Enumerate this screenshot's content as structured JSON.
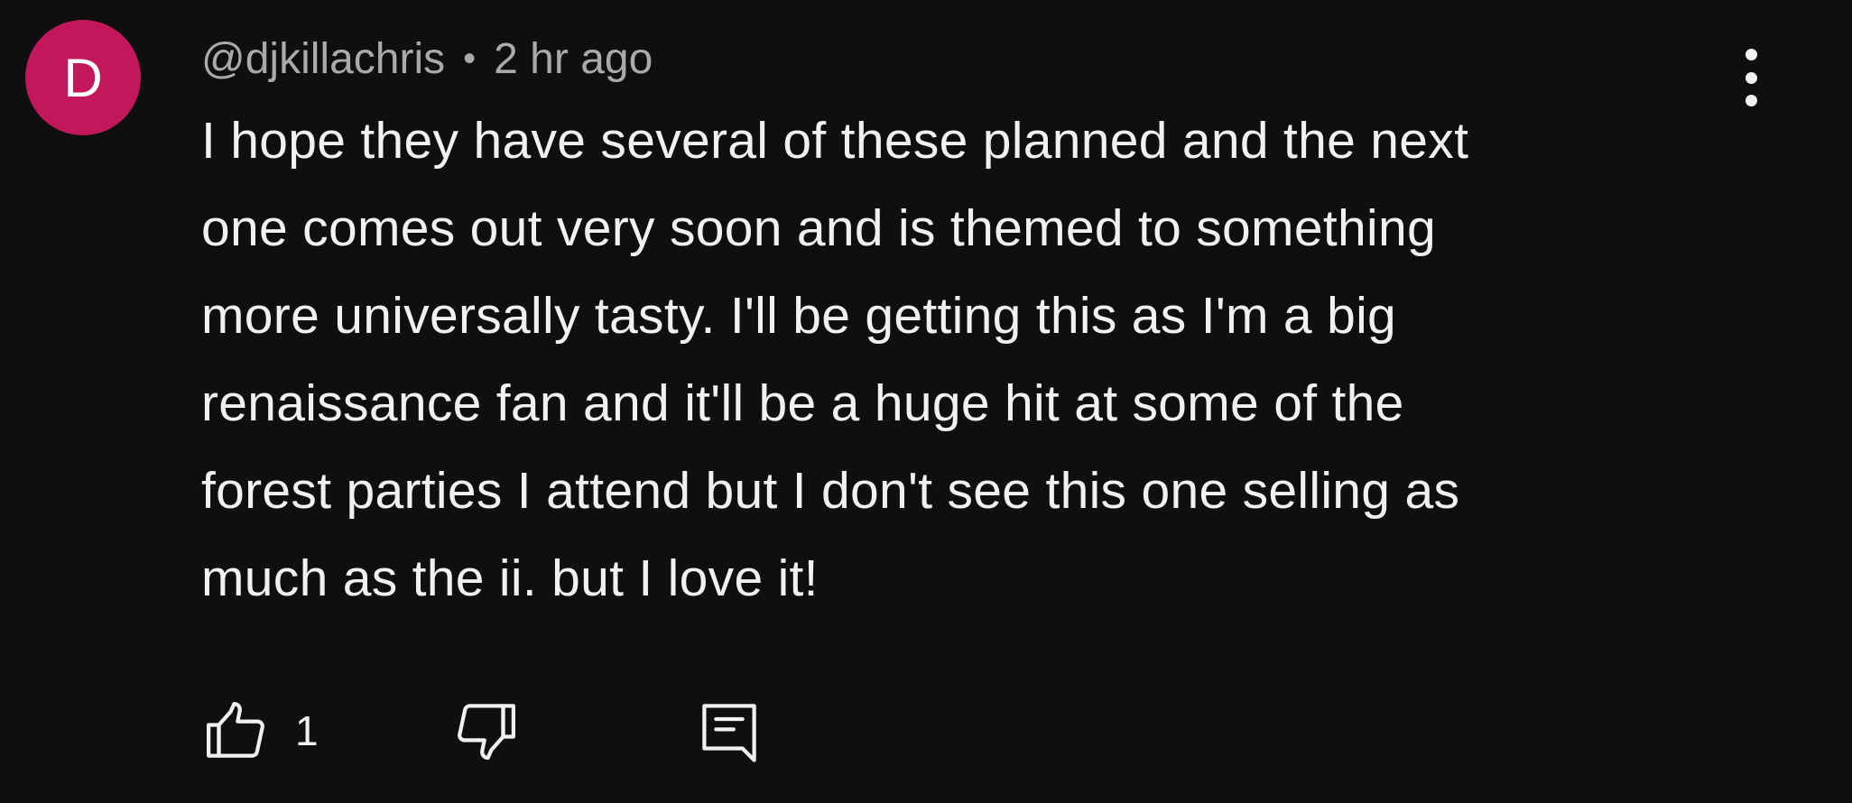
{
  "comment": {
    "avatar_initial": "D",
    "avatar_color": "#c2185b",
    "author": "@djkillachris",
    "separator": "•",
    "timestamp": "2 hr ago",
    "text": "I hope they have several of these planned and the next\none comes out very soon and is themed to something\nmore universally tasty. I'll be getting this as I'm a big\nrenaissance fan and it'll be a huge hit at some of the\nforest parties I attend but I don't see this one selling as\nmuch as the ii. but I love it!",
    "like_count": "1"
  },
  "icons": {
    "more": "more-vertical-icon",
    "like": "thumbs-up-icon",
    "dislike": "thumbs-down-icon",
    "reply": "comment-reply-icon"
  },
  "colors": {
    "background": "#0f0f0f",
    "text": "#f1f1f1",
    "secondary_text": "#aaaaaa"
  }
}
